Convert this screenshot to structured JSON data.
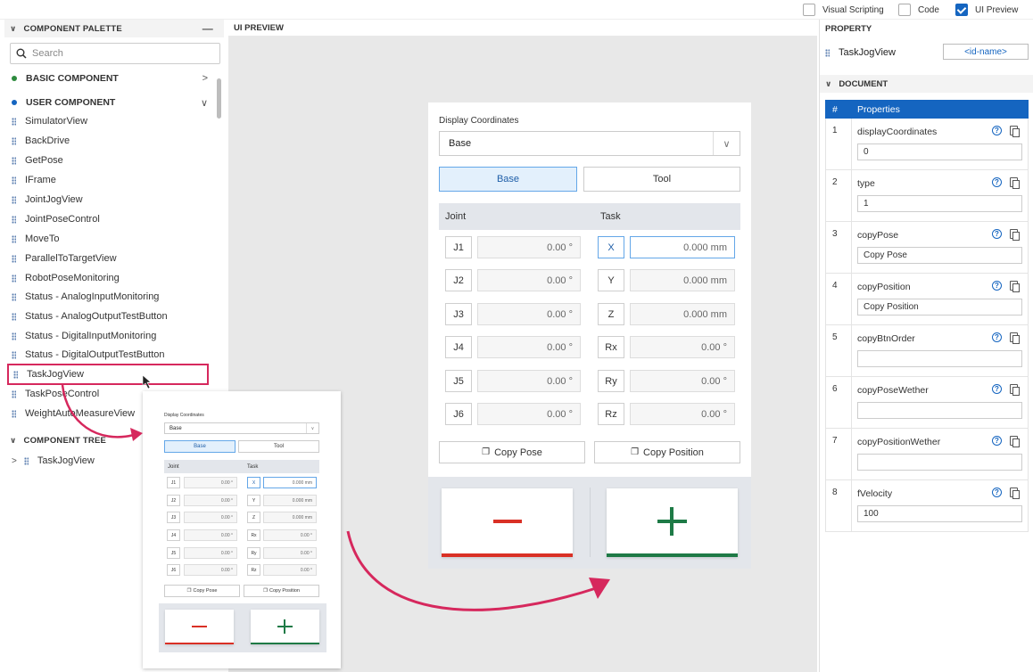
{
  "topbar": {
    "visual_scripting": "Visual Scripting",
    "code": "Code",
    "ui_preview": "UI Preview"
  },
  "palette": {
    "title": "COMPONENT PALETTE",
    "search_placeholder": "Search",
    "basic_group": "BASIC COMPONENT",
    "user_group": "USER COMPONENT",
    "items": [
      "SimulatorView",
      "BackDrive",
      "GetPose",
      "IFrame",
      "JointJogView",
      "JointPoseControl",
      "MoveTo",
      "ParallelToTargetView",
      "RobotPoseMonitoring",
      "Status - AnalogInputMonitoring",
      "Status - AnalogOutputTestButton",
      "Status - DigitalInputMonitoring",
      "Status - DigitalOutputTestButton",
      "TaskJogView",
      "TaskPoseControl",
      "WeightAutoMeasureView"
    ],
    "tree_title": "COMPONENT TREE",
    "tree_item": "TaskJogView"
  },
  "preview": {
    "title": "UI PREVIEW"
  },
  "jog": {
    "display_label": "Display Coordinates",
    "select_value": "Base",
    "seg_base": "Base",
    "seg_tool": "Tool",
    "col_joint": "Joint",
    "col_task": "Task",
    "joints": [
      {
        "name": "J1",
        "value": "0.00 °"
      },
      {
        "name": "J2",
        "value": "0.00 °"
      },
      {
        "name": "J3",
        "value": "0.00 °"
      },
      {
        "name": "J4",
        "value": "0.00 °"
      },
      {
        "name": "J5",
        "value": "0.00 °"
      },
      {
        "name": "J6",
        "value": "0.00 °"
      }
    ],
    "tasks": [
      {
        "name": "X",
        "value": "0.000 mm"
      },
      {
        "name": "Y",
        "value": "0.000 mm"
      },
      {
        "name": "Z",
        "value": "0.000 mm"
      },
      {
        "name": "Rx",
        "value": "0.00 °"
      },
      {
        "name": "Ry",
        "value": "0.00 °"
      },
      {
        "name": "Rz",
        "value": "0.00 °"
      }
    ],
    "copy_pose": "Copy Pose",
    "copy_position": "Copy Position"
  },
  "property": {
    "title": "PROPERTY",
    "component": "TaskJogView",
    "id_placeholder": "<id-name>",
    "document_title": "DOCUMENT",
    "col_num": "#",
    "col_props": "Properties",
    "rows": [
      {
        "num": "1",
        "name": "displayCoordinates",
        "value": "0"
      },
      {
        "num": "2",
        "name": "type",
        "value": "1"
      },
      {
        "num": "3",
        "name": "copyPose",
        "value": "Copy Pose"
      },
      {
        "num": "4",
        "name": "copyPosition",
        "value": "Copy Position"
      },
      {
        "num": "5",
        "name": "copyBtnOrder",
        "value": ""
      },
      {
        "num": "6",
        "name": "copyPoseWether",
        "value": ""
      },
      {
        "num": "7",
        "name": "copyPositionWether",
        "value": ""
      },
      {
        "num": "8",
        "name": "fVelocity",
        "value": "100"
      }
    ]
  },
  "colors": {
    "accent": "#1565c0",
    "highlight": "#d6285d",
    "minus": "#d93025",
    "plus": "#1e7a46"
  }
}
